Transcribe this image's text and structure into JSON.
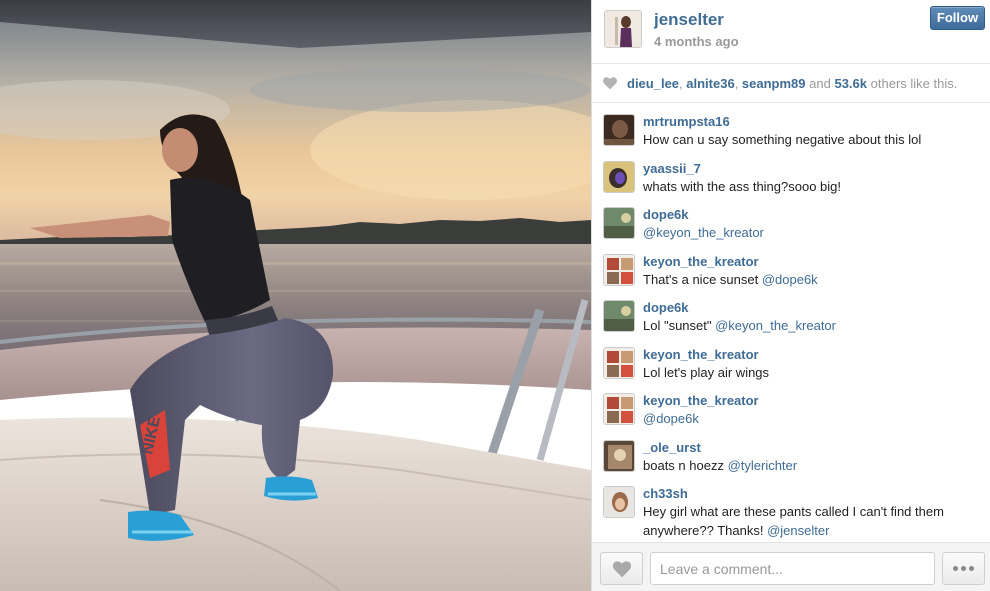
{
  "post": {
    "owner": "jenselter",
    "timestamp": "4 months ago",
    "follow_label": "Follow",
    "photo_logo_text": "NIKE"
  },
  "likes": {
    "users": [
      "dieu_lee",
      "alnite36",
      "seanpm89"
    ],
    "and_text": "and",
    "count": "53.6k",
    "suffix": "others like this."
  },
  "comments": [
    {
      "user": "mrtrumpsta16",
      "text": "How can u say something negative about this lol",
      "mention": ""
    },
    {
      "user": "yaassii_7",
      "text": "whats with the ass thing?sooo big!",
      "mention": ""
    },
    {
      "user": "dope6k",
      "text": "",
      "mention": "@keyon_the_kreator"
    },
    {
      "user": "keyon_the_kreator",
      "text": "That's a nice sunset ",
      "mention": "@dope6k"
    },
    {
      "user": "dope6k",
      "text": "Lol \"sunset\" ",
      "mention": "@keyon_the_kreator"
    },
    {
      "user": "keyon_the_kreator",
      "text": "Lol let's play air wings",
      "mention": ""
    },
    {
      "user": "keyon_the_kreator",
      "text": "",
      "mention": "@dope6k"
    },
    {
      "user": "_ole_urst",
      "text": "boats n hoezz ",
      "mention": "@tylerichter"
    },
    {
      "user": "ch33sh",
      "text": "Hey girl what are these pants called I can't find them anywhere?? Thanks! ",
      "mention": "@jenselter"
    }
  ],
  "footer": {
    "comment_placeholder": "Leave a comment..."
  },
  "icons": {
    "likes": "heart-icon",
    "like_button": "heart-icon",
    "more_button": "ellipsis-icon"
  },
  "colors": {
    "link": "#3f6c94",
    "follow_button": "#4b79a6",
    "muted": "#999999"
  }
}
